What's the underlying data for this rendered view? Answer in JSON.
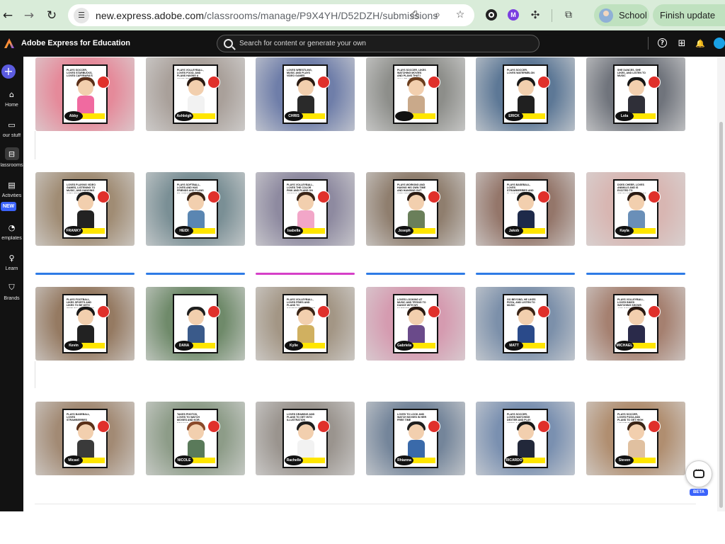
{
  "browser": {
    "back_icon": "←",
    "forward_icon": "→",
    "reload_icon": "↻",
    "site_info_icon": "☰",
    "url_host": "new.express.adobe.com",
    "url_path": "/classrooms/manage/P9X4YH/D52DZH/submissions",
    "install_icon": "⎙",
    "zoom_icon": "⌕",
    "bookmark_icon": "☆",
    "ext_m_label": "M",
    "profile_label": "School",
    "update_label": "Finish update"
  },
  "app": {
    "title": "Adobe Express for Education",
    "search_placeholder": "Search for content or generate your own",
    "help_icon": "?",
    "apps_icon": "⊞",
    "bell_icon": "🔔"
  },
  "sidebar": {
    "add_icon": "+",
    "new_badge": "NEW",
    "items": [
      {
        "label": "Home",
        "icon": "⌂"
      },
      {
        "label": "our stuff",
        "icon": "▭"
      },
      {
        "label": "lassrooms",
        "icon": "⊟"
      },
      {
        "label": "Activities",
        "icon": "▤"
      },
      {
        "label": "emplates",
        "icon": "◔"
      },
      {
        "label": "Learn",
        "icon": "♀"
      },
      {
        "label": "Brands",
        "icon": "⛉"
      }
    ]
  },
  "chat": {
    "beta_label": "BETA"
  },
  "rows": [
    {
      "cards": [
        {
          "name": "Abby",
          "caption": "PLAYS SOCCER, LOVES STARBUCKS, LOVES CAPYBARA'S",
          "bg": "#e58a9a",
          "shirt": "#f06aa0",
          "hair": "#5a2e18"
        },
        {
          "name": "Ashleigh",
          "caption": "Plays Volleyball, loves food, and plans having a good senior year",
          "bg": "#a9a09a",
          "shirt": "#f2f2f2",
          "hair": "#2a1a12"
        },
        {
          "name": "CHRIS",
          "caption": "LOVES WRESTLING, MUSIC AND PLAYS VIDEO GAMES",
          "bg": "#6f7ea9",
          "shirt": "#2a2a2a",
          "hair": "#2a1a12"
        },
        {
          "name": "",
          "caption": "PLAYS SOCCER, LIKES WATCHING MOVIES AND PLANS THAT I CALLED UP TO VARSITY FOR STATES",
          "bg": "#8d8e8a",
          "shirt": "#c9a98a",
          "hair": "#6b3e1e"
        },
        {
          "name": "ERICK",
          "caption": "PLAYS SOCCER, LOVES WATERMELON",
          "bg": "#5d7896",
          "shirt": "#202020",
          "hair": "#181818"
        },
        {
          "name": "Lola",
          "caption": "She dances, she likes, and listen to music",
          "bg": "#70747c",
          "shirt": "#2f2f38",
          "hair": "#151515"
        }
      ]
    },
    {
      "cards": [
        {
          "name": "FRANKY",
          "caption": "LOVES PLAYING VIDEO GAMES, LISTENING TO MUSIC, AND HANGING WITH FRIENDS",
          "bg": "#a08c74",
          "shirt": "#222222",
          "hair": "#1a1a1a"
        },
        {
          "name": "HEIDI",
          "caption": "PLAYS SOFTBALL, LOVES AND HAS FRIENDS AND PLANS TO GET BETTER AT ENGLISH",
          "bg": "#7a8f95",
          "shirt": "#5a86b2",
          "hair": "#3a2416"
        },
        {
          "name": "Isabella",
          "caption": "PLAYS VOLLEYBALL, LOVES THE COLOR PINK AND PLANS ON JOINING CLUB VOLLEYBALL THIS YEAR",
          "bg": "#8e8aa0",
          "shirt": "#f2a6c8",
          "hair": "#3a2416"
        },
        {
          "name": "Joseph",
          "caption": "PLAYS WORKING AND HAVING HIS OWN TIME AND HANGING OUT WITH FRIENDS",
          "bg": "#8f7e6e",
          "shirt": "#6a7f5a",
          "hair": "#2a1a12"
        },
        {
          "name": "Jakob",
          "caption": "PLAYS BASEBALL, LOVES STRAWBERRIES AND PLANS TO GET ALL CONFIDENCE FOR BASEBALL",
          "bg": "#94766a",
          "shirt": "#1e2a4a",
          "hair": "#181818"
        },
        {
          "name": "Kayla",
          "caption": "DOES CHEER, LOVES ANIMALS AND IS EXCITED TO GRADUATE FROM OCC",
          "bg": "#d8b6b2",
          "shirt": "#6a8fb8",
          "hair": "#2a1a12"
        }
      ]
    },
    {
      "cards": [
        {
          "name": "Kevin",
          "caption": "PLAYS FOOTBALL, LIKES SPORTS AND LIKES TO BE WITH FRIENDS AND WHERE THE FUN GOES",
          "bg": "#957a62",
          "shirt": "#222222",
          "hair": "#181818"
        },
        {
          "name": "DANA",
          "caption": "",
          "bg": "#6f8a6a",
          "shirt": "#3a5a8a",
          "hair": "#1e1e1e"
        },
        {
          "name": "Kylie",
          "caption": "PLAYS VOLLEYBALL, LOVES FRIES AND PLANS TO SOMEWHERE DANCES THIS YEAR",
          "bg": "#a39685",
          "shirt": "#d0b060",
          "hair": "#3a2416"
        },
        {
          "name": "Gabriela",
          "caption": "LOVES LOOKING AT MUSIC AND TRYING TO DANCE WITH MY PARTNER",
          "bg": "#d59bb0",
          "shirt": "#6a4a8a",
          "hair": "#2a1a12"
        },
        {
          "name": "MATT",
          "caption": "GO BEYOND, HE LIKES PIZZA, AND LISTEN TO MUSIC",
          "bg": "#7c90aa",
          "shirt": "#2a4a8a",
          "hair": "#3a2416"
        },
        {
          "name": "MICHAEL",
          "caption": "PLAYS VOLLEYBALL, LOVES BIKES WATCHING SHOWS AND GOING OUT",
          "bg": "#a58070",
          "shirt": "#2a2a4a",
          "hair": "#2a1a12"
        }
      ]
    },
    {
      "cards": [
        {
          "name": "Micael",
          "caption": "PLAYS BASEBALL, LOVES STRAWBERRIES",
          "bg": "#a28a74",
          "shirt": "#3a3a3a",
          "hair": "#5a3018"
        },
        {
          "name": "NICOLE",
          "caption": "TAKES PHOTOS, LOVES TO WATCH MOVIES AND KOR-DRAMAS",
          "bg": "#8d9c88",
          "shirt": "#5a7a5a",
          "hair": "#8a4a2a"
        },
        {
          "name": "Rachelle",
          "caption": "LOVES DRAWING AND PLANS TO GET INTO ILLUSTRATION",
          "bg": "#9a948e",
          "shirt": "#f2f2f2",
          "hair": "#1e1e1e"
        },
        {
          "name": "Rhianna",
          "caption": "LOVES TO LOOK AND WATCH MOVIES IN HER FREE TIME",
          "bg": "#74859a",
          "shirt": "#3a6aaa",
          "hair": "#1e1e1e"
        },
        {
          "name": "RICARDO",
          "caption": "PLAYS SOCCER, LOVES WATCHING DEXTER AND PLAY VIDEO GAMES",
          "bg": "#7a90b0",
          "shirt": "#22283a",
          "hair": "#181818"
        },
        {
          "name": "Steven",
          "caption": "PLAYS SOCCER, LOVES Pizza AND PLANS TO Get High Honor every marking period",
          "bg": "#b08e70",
          "shirt": "#e0c0a0",
          "hair": "#3a2416"
        }
      ]
    }
  ],
  "row_bar_colors": [
    "#2e7be6",
    "#2e7be6",
    "#d640c8",
    "#2e7be6",
    "#2e7be6",
    "#2e7be6"
  ]
}
